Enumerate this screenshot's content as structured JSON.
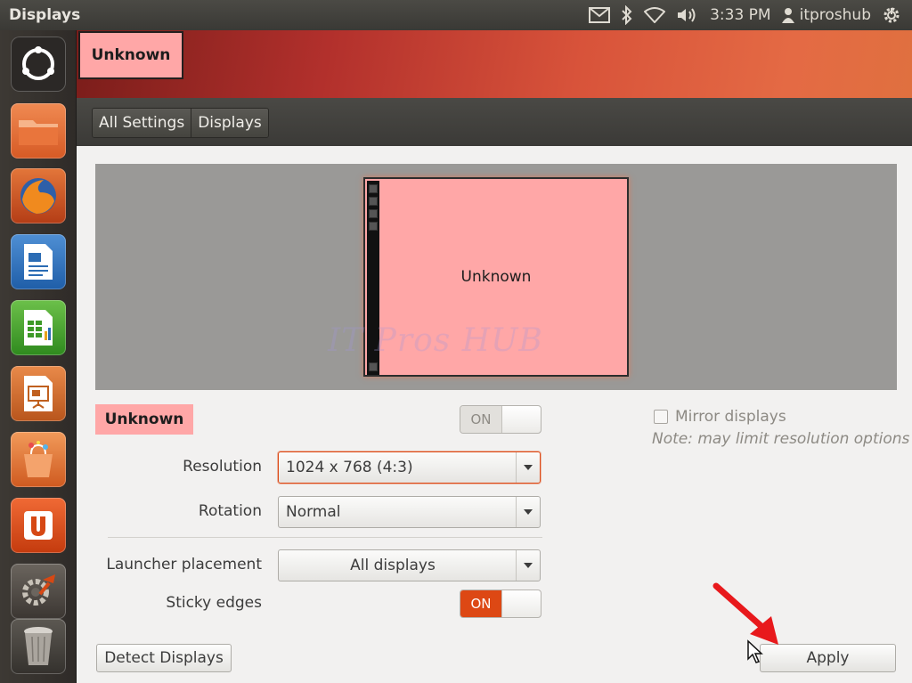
{
  "top_panel": {
    "title": "Displays",
    "clock": "3:33 PM",
    "user": "itproshub",
    "icons": [
      "mail-icon",
      "bluetooth-icon",
      "wifi-icon",
      "volume-icon",
      "user-icon",
      "power-gear-icon"
    ]
  },
  "launcher": {
    "items": [
      "dash-home-icon",
      "files-folder-icon",
      "firefox-icon",
      "writer-icon",
      "calc-icon",
      "impress-icon",
      "software-center-icon",
      "ubuntu-one-icon",
      "system-settings-icon",
      "trash-icon"
    ]
  },
  "header": {
    "display_tab": "Unknown"
  },
  "breadcrumbs": [
    "All Settings",
    "Displays"
  ],
  "arrangement": {
    "monitor_label": "Unknown",
    "watermark": "IT Pros HUB"
  },
  "display": {
    "name": "Unknown",
    "power_toggle": "ON",
    "mirror_label": "Mirror displays",
    "mirror_note": "Note: may limit resolution options",
    "resolution_label": "Resolution",
    "resolution_value": "1024 x 768 (4:3)",
    "rotation_label": "Rotation",
    "rotation_value": "Normal",
    "launcher_placement_label": "Launcher placement",
    "launcher_placement_value": "All displays",
    "sticky_edges_label": "Sticky edges",
    "sticky_edges_toggle": "ON"
  },
  "buttons": {
    "detect": "Detect Displays",
    "apply": "Apply"
  },
  "colors": {
    "accent": "#dd4814",
    "display_highlight": "#ffa7a7"
  }
}
